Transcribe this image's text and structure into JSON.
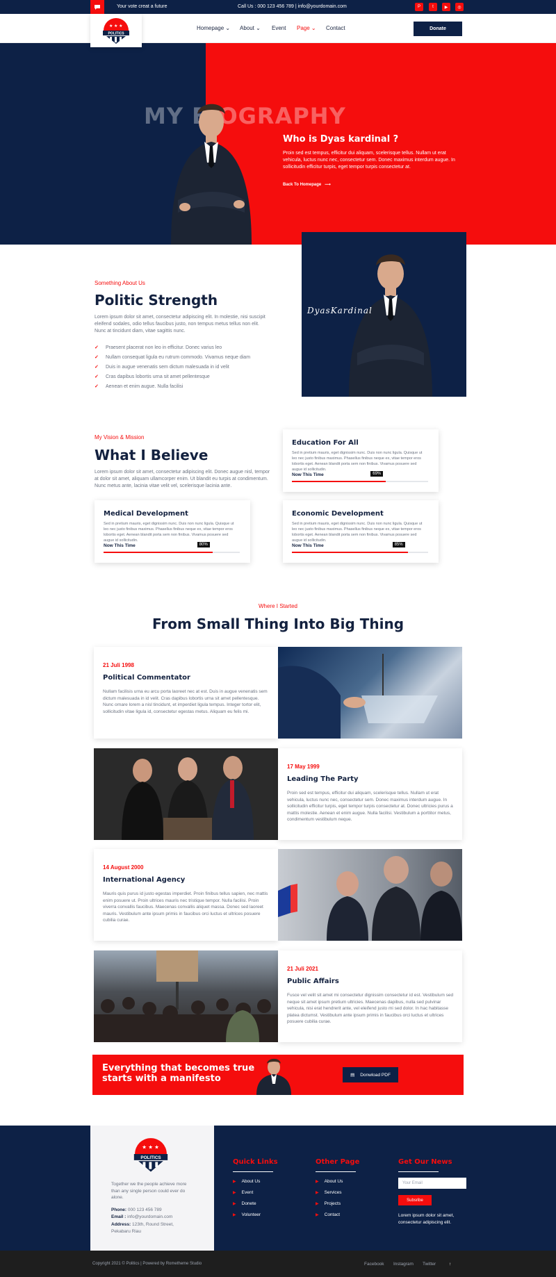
{
  "topbar": {
    "tagline": "Your vote creat a future",
    "call": "Call Us : 000 123 456 789 | info@yourdomain.com"
  },
  "nav": {
    "items": [
      "Homepage",
      "About",
      "Event",
      "Page",
      "Contact"
    ],
    "donate": "Donate"
  },
  "logo": {
    "text": "POLITICS",
    "sub": "VOTE FOR THE FUTURE"
  },
  "hero": {
    "watermark": "MY BIOGRAPHY",
    "heading": "Who is Dyas kardinal ?",
    "text": "Proin sed est tempus, efficitur dui aliquam, scelerisque tellus. Nullam ut erat vehicula, luctus nunc nec, consectetur sem. Donec maximus interdum augue. In sollicitudin efficitur turpis, eget tempor turpis consectetur at.",
    "back": "Back To Homepage"
  },
  "about": {
    "signature": "DyasKardinal",
    "kicker": "Something About Us",
    "title": "Politic Strength",
    "text": "Lorem ipsum dolor sit amet, consectetur adipiscing elit. In molestie, nisi suscipit eleifend sodales, odio tellus faucibus justo, non tempus metus tellus non elit. Nunc at tincidunt diam, vitae sagittis nunc.",
    "points": [
      "Praesent placerat non leo in efficitur. Donec varius leo",
      "Nullam consequat ligula eu rutrum commodo. Vivamus neque diam",
      "Duis in augue venenatis sem dictum malesuada in id velit",
      "Cras dapibus lobortis urna sit amet pellentesque",
      "Aenean et enim augue. Nulla facilisi"
    ]
  },
  "vision": {
    "kicker": "My Vision & Mission",
    "title": "What I Believe",
    "text": "Lorem ipsum dolor sit amet, consectetur adipiscing elit. Donec augue nisl, tempor at dolor sit amet, aliquam ullamcorper enim. Ut blandit eu turpis at condimentum. Nunc metus ante, lacinia vitae velit vel, scelerisque lacinia ante.",
    "now_label": "Now This Time",
    "card_text": "Sed in pretium mauris, eget dignissim nunc. Duis non nunc ligula. Quisque ut leo nec justo finibus maximus. Phasellus finibus neque ex, vitae tempor eros lobortis eget. Aenean blandit porta sem non finibus. Vivamus posuere sed augue id sollicitudin.",
    "cards": [
      {
        "title": "Education For All",
        "percent": "69%",
        "value": 69
      },
      {
        "title": "Medical Development",
        "percent": "80%",
        "value": 80
      },
      {
        "title": "Economic Development",
        "percent": "85%",
        "value": 85
      }
    ]
  },
  "timeline": {
    "kicker": "Where I Started",
    "title": "From Small Thing Into Big Thing",
    "items": [
      {
        "date": "21 Juli 1998",
        "title": "Political Commentator",
        "text": "Nullam facilisis urna eu arcu porta laoreet nec at est. Duis in augue venenatis sem dictum malesuada in id velit. Cras dapibus lobortis urna sit amet pellentesque. Nunc ornare lorem a nisl tincidunt, et imperdiet ligula tempus. Integer tortor elit, sollicitudin vitae ligula id, consectetur egestas metus. Aliquam eu felis mi."
      },
      {
        "date": "17 May 1999",
        "title": "Leading The Party",
        "text": "Proin sed est tempus, efficitur dui aliquam, scelerisque tellus. Nullam ut erat vehicula, luctus nunc nec, consectetur sem. Donec maximus interdum augue. In sollicitudin efficitur turpis, eget tempor turpis consectetur at. Donec ultricies purus a mattis molestie. Aenean et enim augue. Nulla facilisi. Vestibulum a porttitor metus, condimentum vestibulum neque."
      },
      {
        "date": "14 August 2000",
        "title": "International Agency",
        "text": "Mauris quis purus id justo egestas imperdiet. Proin finibus tellus sapien, nec mattis enim posuere ut. Proin ultrices mauris nec tristique tempor. Nulla facilisi. Proin viverra convallis faucibus. Maecenas convallis aliquet massa. Donec sed laoreet mauris. Vestibulum ante ipsum primis in faucibus orci luctus et ultrices posuere cubilia curae."
      },
      {
        "date": "21 Juli 2021",
        "title": "Public Affairs",
        "text": "Fusce vel velit sit amet mi consectetur dignissim consectetur id est. Vestibulum sed neque sit amet ipsum pretium ultricies. Maecenas dapibus, nulla sed pulvinar vehicula, nisi erat hendrerit ante, vel eleifend justo mi sed dolor. In hac habitasse platea dictumst. Vestibulum ante ipsum primis in faucibus orci luctus et ultrices posuere cubilia curae."
      }
    ]
  },
  "cta": {
    "text": "Everything that becomes true starts with a manifesto",
    "button": "Donwload PDF"
  },
  "footer": {
    "about": "Together we the people achieve more than any single person could ever do alone.",
    "phone_label": "Phone:",
    "phone": "000 123 456 789",
    "email_label": "Email :",
    "email": "info@yourdomain.com",
    "address_label": "Address:",
    "address": "123th, Round Street, Pekabaru Riau",
    "quick_title": "Quick Links",
    "quick": [
      "About Us",
      "Event",
      "Donete",
      "Volunteer"
    ],
    "other_title": "Other Page",
    "other": [
      "About Us",
      "Services",
      "Projects",
      "Contact"
    ],
    "news_title": "Get Our News",
    "email_placeholder": "Your Email",
    "subscribe": "Subsribe",
    "news_note": "Lorem ipsum dolor sit amet, consectetur adipiscing elit."
  },
  "bottom": {
    "copyright": "Copyright 2021 © Politics | Powered by Rometheme Studio",
    "links": [
      "Facebook",
      "Instagram",
      "Twitter"
    ]
  },
  "colors": {
    "navy": "#0d2146",
    "red": "#f50d0d"
  }
}
